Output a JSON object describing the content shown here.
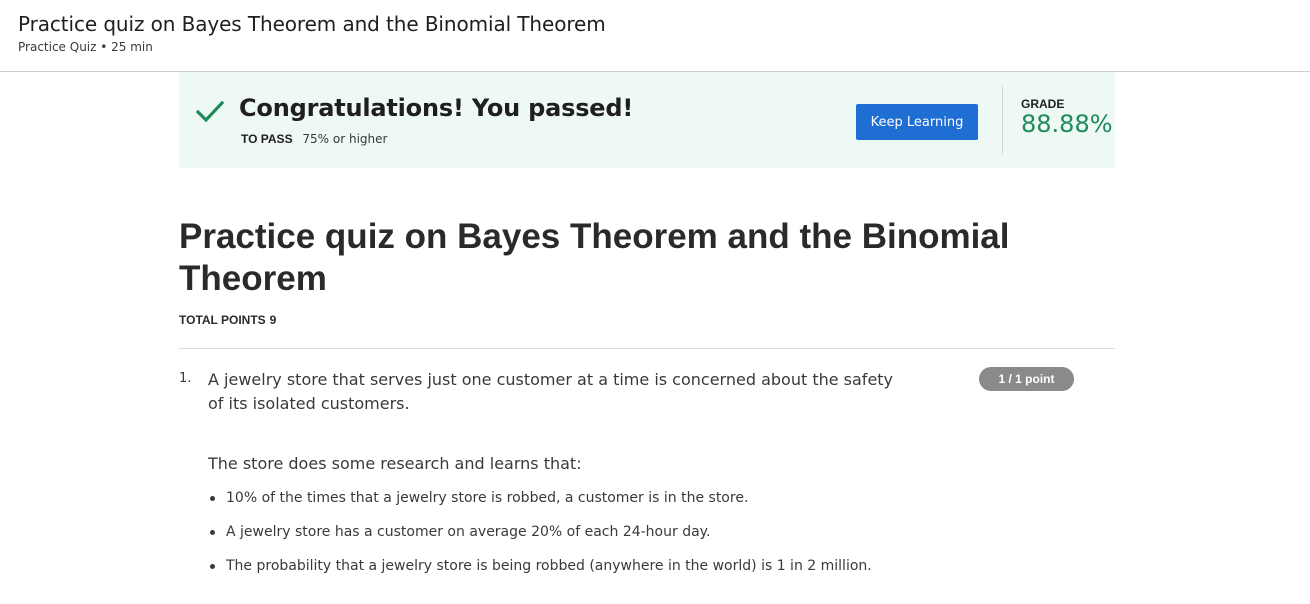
{
  "header": {
    "title": "Practice quiz on Bayes Theorem and the Binomial Theorem",
    "subtitle": "Practice Quiz • 25 min"
  },
  "result_banner": {
    "heading": "Congratulations! You passed!",
    "to_pass_label": "TO PASS",
    "to_pass_value": "75% or higher",
    "keep_learning_label": "Keep Learning",
    "grade_label": "GRADE",
    "grade_value": "88.88%",
    "icon": "checkmark-icon",
    "colors": {
      "banner_bg": "#eef8f4",
      "check": "#1e8a5a",
      "grade": "#1e8a5a",
      "button": "#1f6ed4"
    }
  },
  "quiz": {
    "title": "Practice quiz on Bayes Theorem and the Binomial Theorem",
    "total_points_label": "TOTAL POINTS",
    "total_points_value": "9"
  },
  "question": {
    "number": "1.",
    "text": "A jewelry store that serves just one customer at a time is concerned about the safety of its isolated customers.",
    "points": "1 / 1 point",
    "intro": "The store does some research and learns that:",
    "facts": [
      "10% of the times that a jewelry store is robbed, a customer is in the store.",
      "A jewelry store has a customer on average 20% of each 24-hour day.",
      "The probability that a jewelry store is being robbed (anywhere in the world) is 1 in 2 million."
    ]
  }
}
